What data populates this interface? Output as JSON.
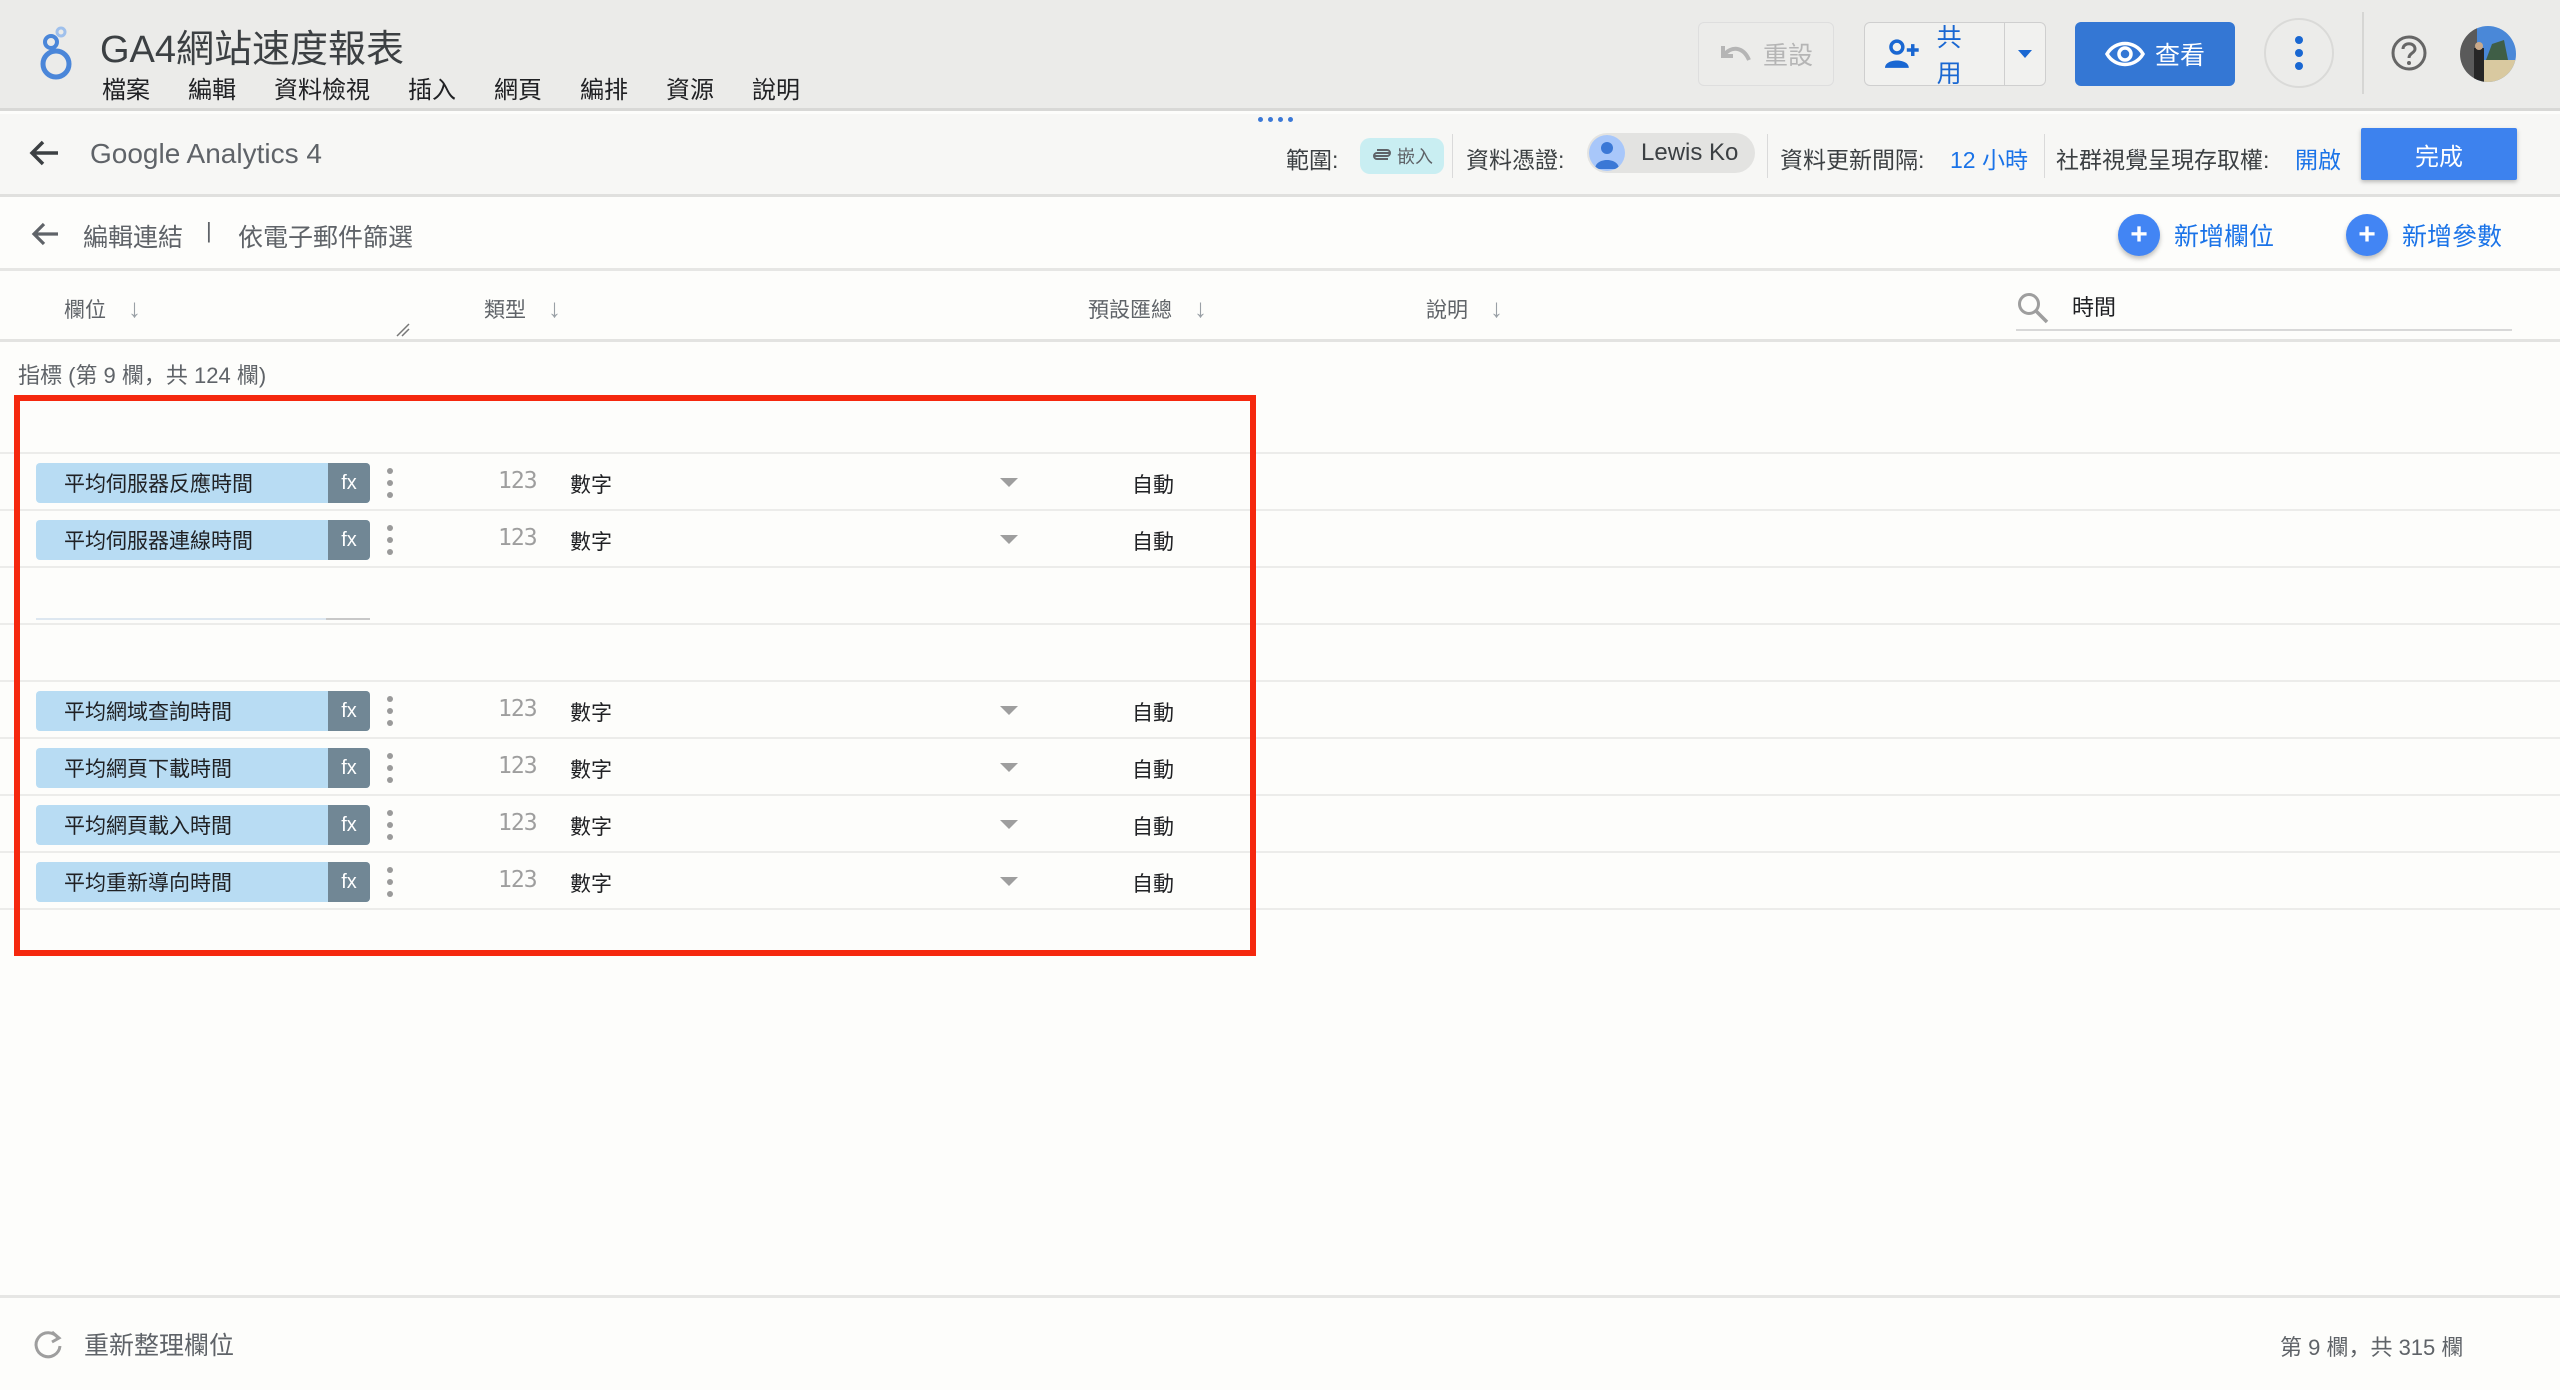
{
  "app": {
    "title": "GA4網站速度報表",
    "menu": [
      "檔案",
      "編輯",
      "資料檢視",
      "插入",
      "網頁",
      "編排",
      "資源",
      "說明"
    ]
  },
  "toolbar": {
    "reset_label": "重設",
    "share_label": "共用",
    "view_label": "查看"
  },
  "source_bar": {
    "name": "Google Analytics 4",
    "scope_label": "範圍:",
    "scope_chip": "嵌入",
    "credentials_label": "資料憑證:",
    "credentials_user": "Lewis Ko",
    "refresh_label": "資料更新間隔:",
    "refresh_value": "12 小時",
    "social_label": "社群視覺呈現存取權:",
    "social_value": "開啟",
    "done_label": "完成"
  },
  "breadcrumb": {
    "items": [
      "編輯連結",
      "依電子郵件篩選"
    ],
    "separator": "|",
    "add_field": "新增欄位",
    "add_param": "新增參數"
  },
  "columns": {
    "field": "欄位",
    "type": "類型",
    "aggregation": "預設匯總",
    "description": "說明",
    "search_value": "時間"
  },
  "section": {
    "label": "指標 (第 9 欄，共 124 欄)"
  },
  "rows": [
    {
      "name": "",
      "empty": true
    },
    {
      "name": "平均伺服器反應時間",
      "fx": "fx",
      "type_icon": "123",
      "type": "數字",
      "agg": "自動"
    },
    {
      "name": "平均伺服器連線時間",
      "fx": "fx",
      "type_icon": "123",
      "type": "數字",
      "agg": "自動"
    },
    {
      "name": "",
      "empty": true,
      "ghost": true
    },
    {
      "name": "",
      "empty": true
    },
    {
      "name": "平均網域查詢時間",
      "fx": "fx",
      "type_icon": "123",
      "type": "數字",
      "agg": "自動"
    },
    {
      "name": "平均網頁下載時間",
      "fx": "fx",
      "type_icon": "123",
      "type": "數字",
      "agg": "自動"
    },
    {
      "name": "平均網頁載入時間",
      "fx": "fx",
      "type_icon": "123",
      "type": "數字",
      "agg": "自動"
    },
    {
      "name": "平均重新導向時間",
      "fx": "fx",
      "type_icon": "123",
      "type": "數字",
      "agg": "自動"
    }
  ],
  "footer": {
    "refresh_label": "重新整理欄位",
    "count": "第 9 欄，共 315 欄"
  },
  "colors": {
    "accent": "#1a73e8",
    "view_button": "#3477d4",
    "done_button": "#3d82ee",
    "chip": "#b8dcf3",
    "fx": "#718795",
    "highlight": "#f5280e"
  }
}
